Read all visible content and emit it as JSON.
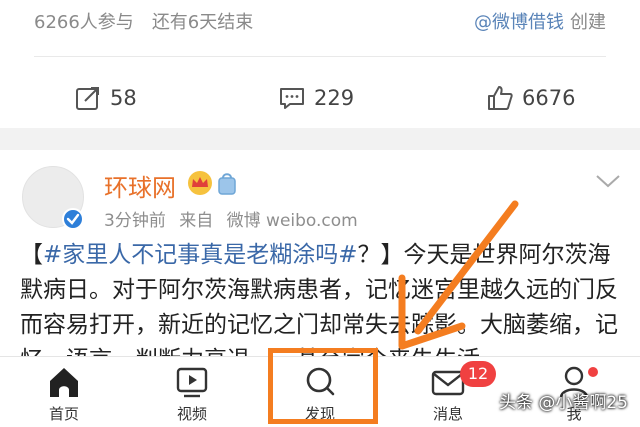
{
  "top_card": {
    "participants": "6266人参与",
    "remaining": "还有6天结束",
    "creator_link": "@微博借钱",
    "creator_suffix": "创建",
    "repost_count": "58",
    "comment_count": "229",
    "like_count": "6676"
  },
  "post": {
    "author": "环球网",
    "time": "3分钟前",
    "source_prefix": "来自",
    "source": "微博 weibo.com",
    "text_open": "【",
    "hashtag": "#家里人不记事真是老糊涂吗#",
    "text_body": "？】今天是世界阿尔茨海默病日。对于阿尔茨海默病患者，记忆迷宫里越久远的门反而容易打开，新近的记忆之门却常失去踪影。大脑萎缩，记忆、语言、判断力衰退……甚至完全丧失生活"
  },
  "tabbar": {
    "home": "首页",
    "video": "视频",
    "discover": "发现",
    "messages": "消息",
    "messages_badge": "12",
    "me": "我"
  },
  "watermark": "头条 @小酱啊25",
  "colors": {
    "accent_orange": "#f47d20",
    "author_orange": "#e8712a",
    "hashtag_blue": "#3a68a8",
    "badge_red": "#f04141"
  },
  "icons": {
    "repost": "repost-icon",
    "comment": "comment-icon",
    "like": "thumbs-up-icon",
    "home": "home-icon",
    "video": "video-icon",
    "discover": "search-icon",
    "messages": "mail-icon",
    "me": "person-icon"
  }
}
